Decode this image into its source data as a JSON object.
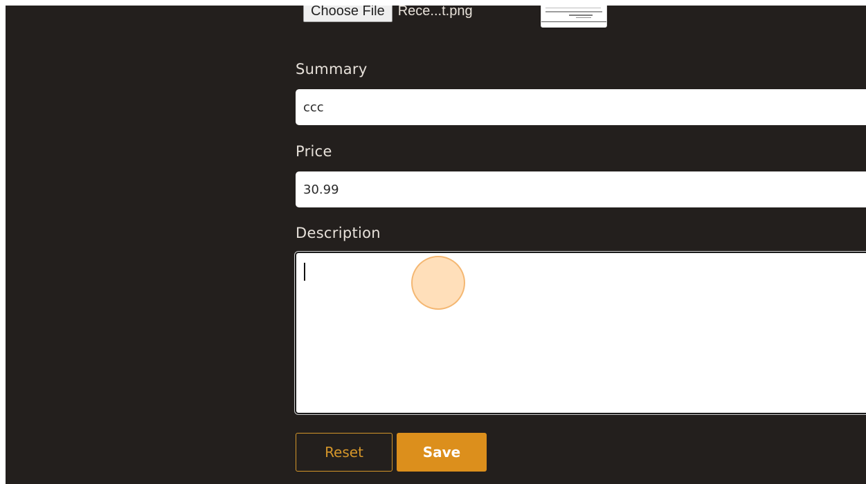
{
  "file_upload": {
    "button_label": "Choose File",
    "file_name": "Rece...t.png"
  },
  "form": {
    "summary": {
      "label": "Summary",
      "value": "ccc"
    },
    "price": {
      "label": "Price",
      "value": "30.99"
    },
    "description": {
      "label": "Description",
      "value": ""
    }
  },
  "actions": {
    "reset_label": "Reset",
    "save_label": "Save"
  },
  "colors": {
    "background": "#231f1d",
    "accent": "#dc8f1c",
    "reset_outline": "#d5962a",
    "click_indicator": "#ffc482"
  }
}
